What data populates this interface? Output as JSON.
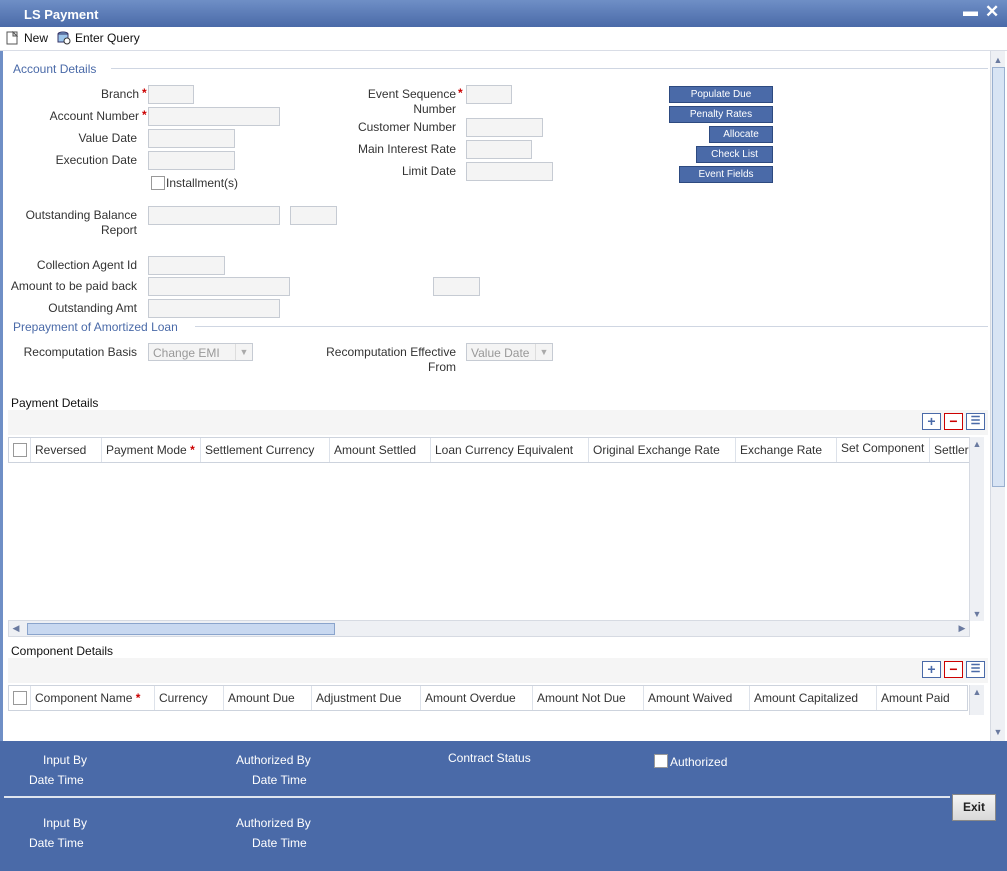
{
  "window": {
    "title": "LS Payment"
  },
  "toolbar": {
    "new_label": "New",
    "enter_query_label": "Enter Query"
  },
  "account_details": {
    "section_title": "Account Details",
    "branch_label": "Branch",
    "account_number_label": "Account Number",
    "value_date_label": "Value Date",
    "execution_date_label": "Execution Date",
    "installments_label": "Installment(s)",
    "event_sequence_label_1": "Event Sequence",
    "event_sequence_label_2": "Number",
    "customer_number_label": "Customer Number",
    "main_interest_rate_label": "Main Interest Rate",
    "limit_date_label": "Limit Date",
    "outstanding_balance_label_1": "Outstanding Balance",
    "outstanding_balance_label_2": "Report",
    "collection_agent_label": "Collection Agent Id",
    "amount_paid_back_label": "Amount to be paid back",
    "outstanding_amt_label": "Outstanding Amt",
    "required_mark": "*"
  },
  "actions": {
    "populate_due": "Populate Due",
    "penalty_rates": "Penalty Rates",
    "allocate": "Allocate",
    "check_list": "Check List",
    "event_fields": "Event Fields"
  },
  "prepayment": {
    "section_title": "Prepayment of Amortized Loan",
    "recomputation_basis_label": "Recomputation Basis",
    "recomputation_basis_value": "Change EMI",
    "effective_from_label_1": "Recomputation Effective",
    "effective_from_label_2": "From",
    "effective_from_value": "Value Date"
  },
  "payment_details": {
    "title": "Payment Details",
    "columns": [
      "Reversed",
      "Payment Mode",
      "Settlement Currency",
      "Amount Settled",
      "Loan Currency Equivalent",
      "Original Exchange Rate",
      "Exchange Rate",
      "Set Component",
      "Settler"
    ]
  },
  "component_details": {
    "title": "Component Details",
    "columns": [
      "Component Name",
      "Currency",
      "Amount Due",
      "Adjustment Due",
      "Amount Overdue",
      "Amount Not Due",
      "Amount Waived",
      "Amount Capitalized",
      "Amount Paid"
    ]
  },
  "footer": {
    "input_by": "Input By",
    "date_time": "Date Time",
    "authorized_by": "Authorized By",
    "contract_status": "Contract Status",
    "authorized": "Authorized",
    "exit": "Exit"
  },
  "icons": {
    "new": "new-document-icon",
    "enter_query": "query-icon",
    "minimize": "minimize-icon",
    "close": "close-icon",
    "add_row": "plus-icon",
    "delete_row": "minus-icon",
    "single_view": "list-view-icon"
  },
  "colors": {
    "title_bar": "#4a6aa8",
    "button": "#4a6aa8",
    "required": "#cc0000"
  }
}
